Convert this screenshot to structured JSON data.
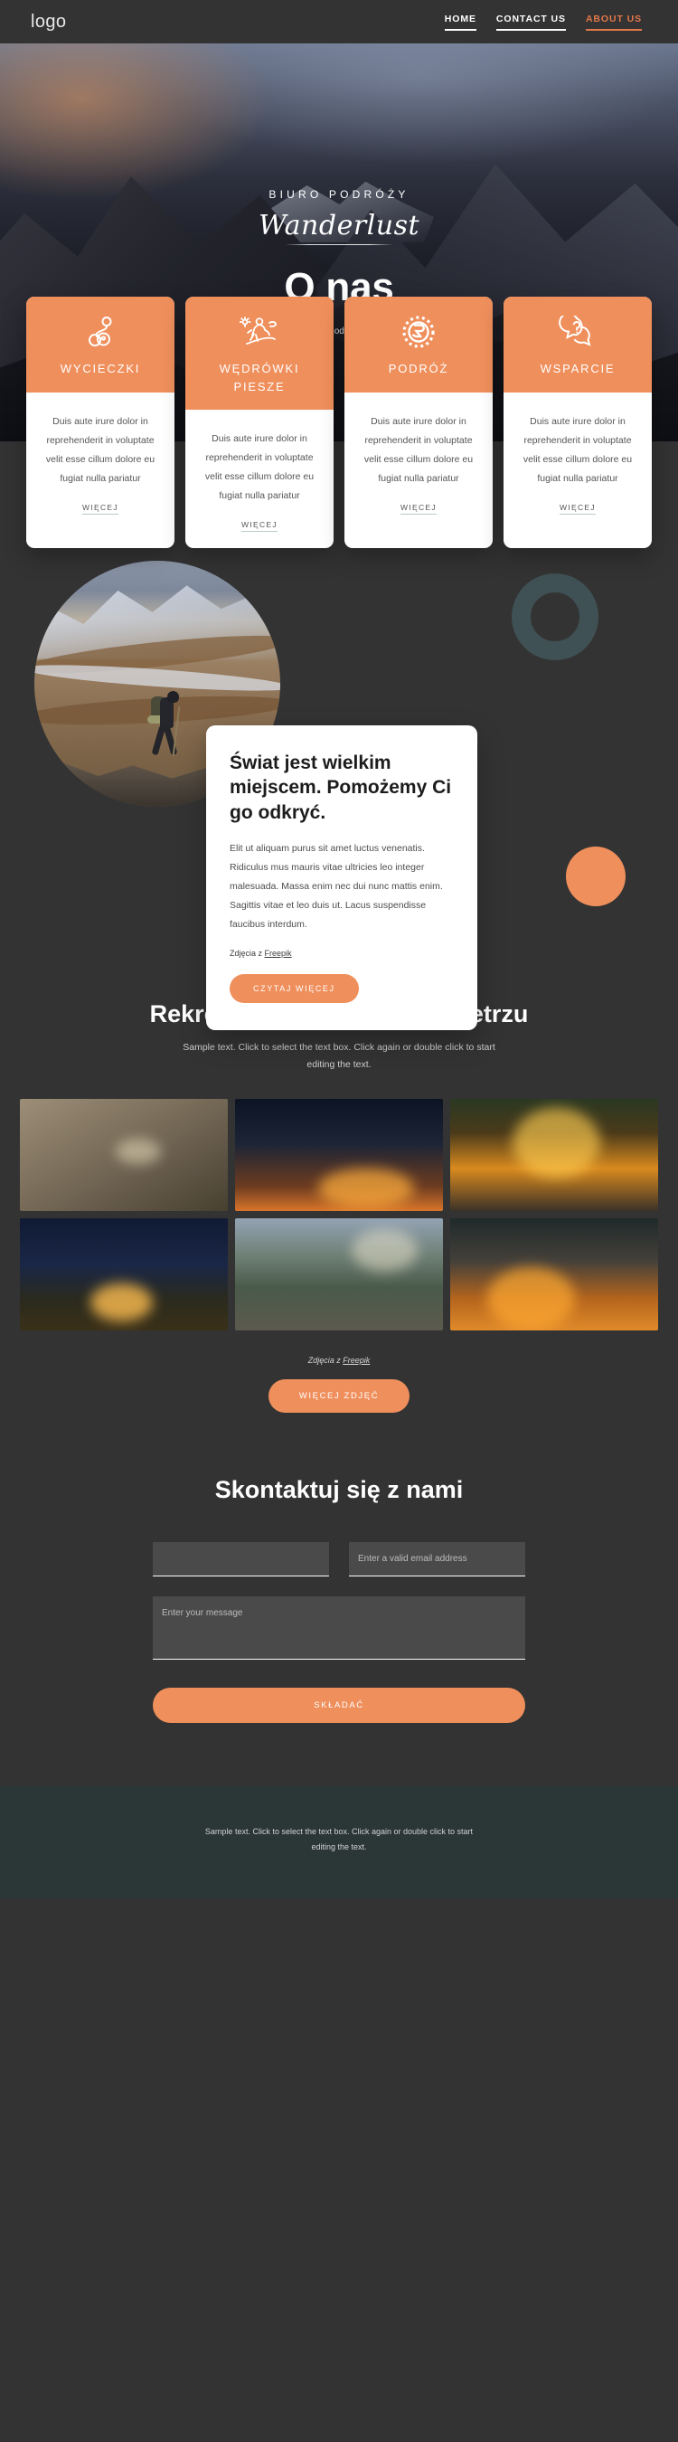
{
  "header": {
    "logo": "logo",
    "nav": [
      {
        "label": "HOME",
        "active": false
      },
      {
        "label": "CONTACT US",
        "active": false
      },
      {
        "label": "ABOUT US",
        "active": true
      }
    ]
  },
  "hero": {
    "kicker": "BIURO PODRÓŻY",
    "script": "Wanderlust",
    "title": "O nas",
    "credit_prefix": "Obraz pochodzi z ",
    "credit_link": "Freepik"
  },
  "cards": [
    {
      "icon": "route-pin-icon",
      "title": "WYCIECZKI",
      "text": "Duis aute irure dolor in reprehenderit in voluptate velit esse cillum dolore eu fugiat nulla pariatur",
      "link": "WIĘCEJ"
    },
    {
      "icon": "hiker-icon",
      "title": "WĘDRÓWKI PIESZE",
      "text": "Duis aute irure dolor in reprehenderit in voluptate velit esse cillum dolore eu fugiat nulla pariatur",
      "link": "WIĘCEJ"
    },
    {
      "icon": "globe-icon",
      "title": "PODRÓŻ",
      "text": "Duis aute irure dolor in reprehenderit in voluptate velit esse cillum dolore eu fugiat nulla pariatur",
      "link": "WIĘCEJ"
    },
    {
      "icon": "question-chat-icon",
      "title": "WSPARCIE",
      "text": "Duis aute irure dolor in reprehenderit in voluptate velit esse cillum dolore eu fugiat nulla pariatur",
      "link": "WIĘCEJ"
    }
  ],
  "story": {
    "photo_alt": "hiker-crossing-stream-photo",
    "title": "Świat jest wielkim miejscem. Pomożemy Ci go odkryć.",
    "text": "Elit ut aliquam purus sit amet luctus venenatis. Ridiculus mus mauris vitae ultricies leo integer malesuada. Massa enim nec dui nunc mattis enim. Sagittis vitae et leo duis ut. Lacus suspendisse faucibus interdum.",
    "credit_prefix": "Zdjęcia z ",
    "credit_link": "Freepik",
    "button": "CZYTAJ WIĘCEJ"
  },
  "gallery": {
    "title": "Rekreacja na świeżym powietrzu",
    "subtitle": "Sample text. Click to select the text box. Click again or double click to start editing the text.",
    "tiles": [
      "camp-breakfast-photo",
      "friends-roasting-marshmallows-photo",
      "campfire-logs-photo",
      "lit-tent-at-night-photo",
      "mountain-valley-stream-photo",
      "couple-by-campfire-photo"
    ],
    "credit_prefix": "Zdjęcia z ",
    "credit_link": "Freepik",
    "button": "WIĘCEJ ZDJĘĆ"
  },
  "contact": {
    "title": "Skontaktuj się z nami",
    "name_value": "",
    "name_placeholder": "",
    "email_placeholder": "Enter a valid email address",
    "email_value": "",
    "message_placeholder": "Enter your message",
    "message_value": "",
    "submit": "SKŁADAĆ"
  },
  "footer": {
    "text": "Sample text. Click to select the text box. Click again or double click to start editing the text."
  },
  "colors": {
    "accent": "#ef8f5c",
    "background": "#333333",
    "footer": "#2b3636",
    "ring": "#3f5154",
    "card": "#ffffff"
  }
}
